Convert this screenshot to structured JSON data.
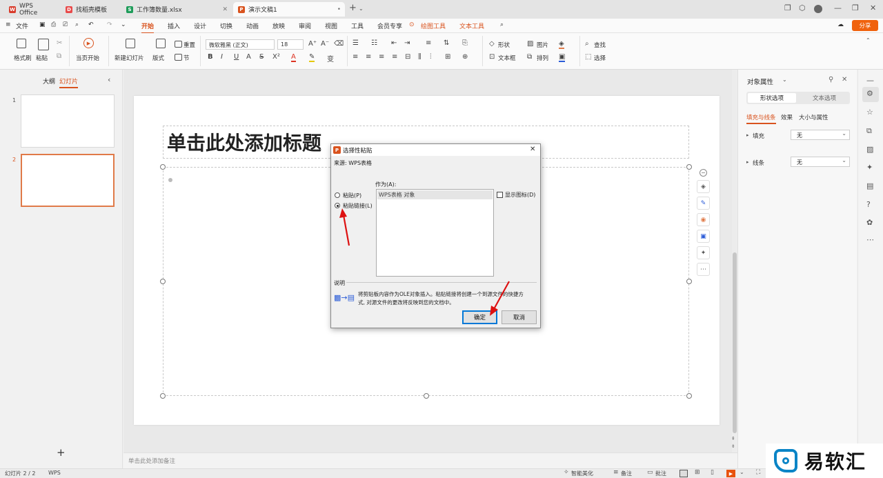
{
  "titlebar": {
    "tabs": [
      {
        "label": "WPS Office",
        "icon": "wps-logo-icon",
        "color": "#d83b2b"
      },
      {
        "label": "找稻壳模板",
        "icon": "docer-icon",
        "color": "#e84a4a"
      },
      {
        "label": "工作簿数量.xlsx",
        "icon": "spreadsheet-icon",
        "color": "#1f9c5a"
      },
      {
        "label": "演示文稿1",
        "icon": "presentation-icon",
        "color": "#d9531e"
      }
    ],
    "new_tab": "+"
  },
  "menubar": {
    "file": "文件",
    "items": [
      "开始",
      "插入",
      "设计",
      "切换",
      "动画",
      "放映",
      "审阅",
      "视图",
      "工具",
      "会员专享"
    ],
    "context_items": [
      "绘图工具",
      "文本工具"
    ],
    "share": "分享",
    "active": "开始"
  },
  "ribbon": {
    "format_painter": "格式刷",
    "paste": "粘贴",
    "from_current": "当页开始",
    "new_slide": "新建幻灯片",
    "layout": "版式",
    "section": "节",
    "reset": "重置",
    "font_name": "微软雅黑 (正文)",
    "font_size": "18",
    "shape": "形状",
    "picture": "图片",
    "textbox": "文本框",
    "arrange": "排列",
    "find": "查找",
    "select": "选择"
  },
  "leftpane": {
    "outline_tab": "大纲",
    "slides_tab": "幻灯片",
    "slide_numbers": [
      "1",
      "2"
    ],
    "add": "+"
  },
  "slide": {
    "title_placeholder": "单击此处添加标题"
  },
  "notes": {
    "placeholder": "单击此处添加备注"
  },
  "rightpane": {
    "title": "对象属性",
    "tabs": [
      "形状选项",
      "文本选项"
    ],
    "subtabs": [
      "填充与线条",
      "效果",
      "大小与属性"
    ],
    "fill_label": "填充",
    "fill_value": "无",
    "line_label": "线条",
    "line_value": "无"
  },
  "dialog": {
    "title": "选择性粘贴",
    "source": "来源: WPS表格",
    "as_label": "作为(A):",
    "options": [
      "粘贴(P)",
      "粘贴链接(L)"
    ],
    "selected_option": "粘贴链接(L)",
    "list_item": "WPS表格 对象",
    "show_icon": "显示图标(D)",
    "desc_label": "说明",
    "desc_line1": "将剪贴板内容作为OLE对象插入。粘贴链接将创建一个到源文件的快捷方",
    "desc_line2": "式, 对源文件的更改将反映到您的文档中。",
    "ok": "确定",
    "cancel": "取消"
  },
  "statusbar": {
    "slide_count": "幻灯片 2 / 2",
    "wps": "WPS",
    "smart": "智能美化",
    "notes": "备注",
    "comments": "批注"
  },
  "watermark": {
    "text": "易软汇"
  }
}
